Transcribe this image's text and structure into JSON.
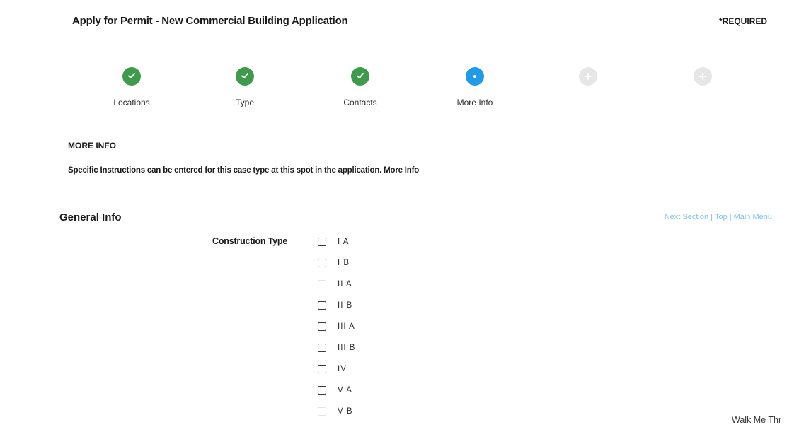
{
  "header": {
    "title": "Apply for Permit - New Commercial Building Application",
    "required_note": "*REQUIRED"
  },
  "wizard": {
    "steps": [
      {
        "label": "Locations",
        "status": "complete"
      },
      {
        "label": "Type",
        "status": "complete"
      },
      {
        "label": "Contacts",
        "status": "complete"
      },
      {
        "label": "More Info",
        "status": "current"
      },
      {
        "label": "",
        "status": "pending"
      },
      {
        "label": "",
        "status": "pending"
      }
    ]
  },
  "more_info": {
    "heading": "MORE INFO",
    "instructions": "Specific Instructions can be entered for this case type at this spot in the application. More Info"
  },
  "general_info": {
    "heading": "General Info",
    "nav": {
      "next_section": "Next Section",
      "top": "Top",
      "main_menu": "Main Menu",
      "separator": "|"
    },
    "construction_type": {
      "label": "Construction Type",
      "options": [
        "I A",
        "I B",
        "II A",
        "II B",
        "III A",
        "III B",
        "IV",
        "V A",
        "V B"
      ]
    }
  },
  "walkme": {
    "label": "Walk Me Thr"
  },
  "colors": {
    "complete": "#3e9b4c",
    "current": "#1f9bea",
    "pending": "#e6e6e6",
    "link": "#7ec3ea"
  }
}
